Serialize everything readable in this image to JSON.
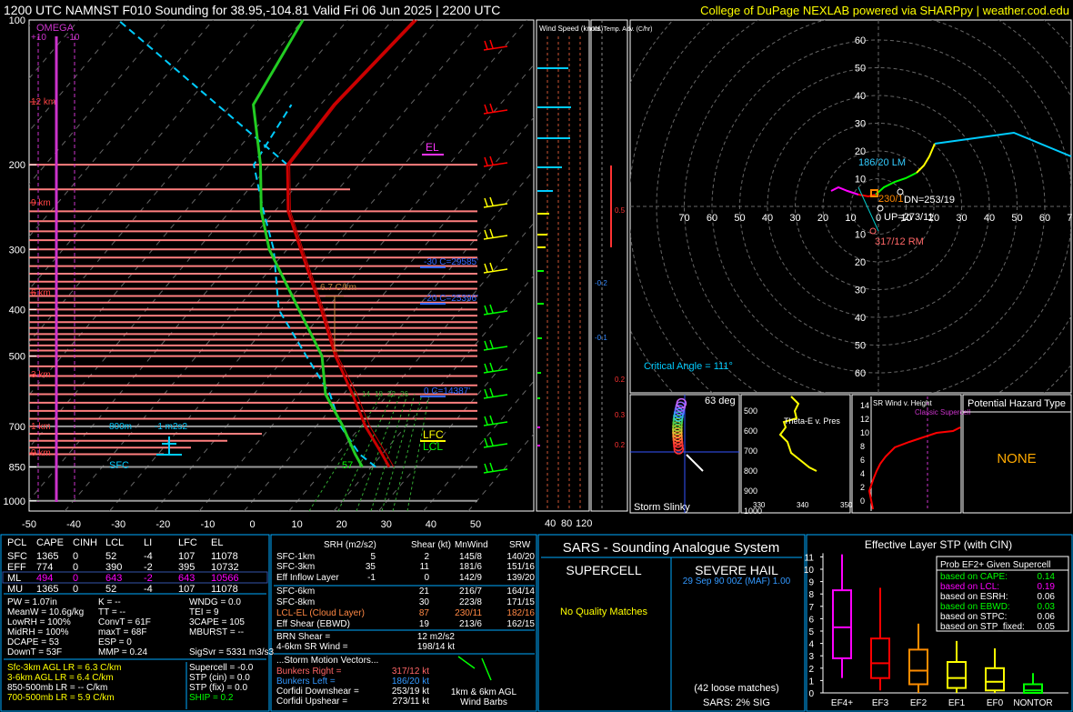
{
  "header": {
    "title": "1200 UTC NAMNST F010 Sounding for 38.95,-104.81 Valid  Fri 06 Jun 2025 | 2200 UTC",
    "credit": "College of DuPage NEXLAB powered via SHARPpy | weather.cod.edu"
  },
  "colors": {
    "temperature": "#ff0000",
    "dewpoint": "#00cc00",
    "wetbulb": "#00ccff",
    "parcel": "#ffffff",
    "level_lines": "#ff6666",
    "axis": "#ffffff"
  },
  "skewt": {
    "pressure_ticks": [
      "100",
      "200",
      "300",
      "400",
      "500",
      "700",
      "850",
      "1000"
    ],
    "temp_ticks": [
      "-50",
      "-40",
      "-30",
      "-20",
      "-10",
      "0",
      "10",
      "20",
      "30",
      "40",
      "50"
    ],
    "omega_label": "OMEGA",
    "omega_ticks": [
      "+10",
      "-10"
    ],
    "height_labels": [
      "12 km",
      "9 km",
      "6 km",
      "3 km",
      "1 km",
      "0 km"
    ],
    "el_label": "EL",
    "lfc_label": "LFC",
    "lcl_label": "LCL",
    "sfc_label": "SFC",
    "m30c_label": "-30 C=29585'",
    "m20c_label": "-20 C=25396'",
    "zero_label": "0 C=14387'",
    "lapse_label": "6.7 C/km",
    "m800_label": "800m",
    "srh_label": "-1 m2s2",
    "sfc_cape_label": "57",
    "mixratio_labels": [
      "10",
      "14",
      "18",
      "22",
      "26"
    ],
    "chart_data": {
      "type": "line",
      "xlabel": "",
      "ylabel": "",
      "ylim": [
        1000,
        100
      ],
      "xlim": [
        -50,
        50
      ],
      "series": [
        {
          "name": "",
          "points": [
            [
              1000,
              null
            ],
            [
              850,
              24
            ],
            [
              800,
              20
            ],
            [
              700,
              11
            ],
            [
              600,
              2
            ],
            [
              500,
              -9
            ],
            [
              400,
              -21
            ],
            [
              300,
              -37
            ],
            [
              250,
              -47
            ],
            [
              200,
              -56
            ],
            [
              150,
              -57
            ],
            [
              100,
              -55
            ]
          ]
        },
        {
          "name": "",
          "points": [
            [
              850,
              18
            ],
            [
              800,
              14
            ],
            [
              700,
              6
            ],
            [
              600,
              -4
            ],
            [
              500,
              -12
            ],
            [
              400,
              -26
            ],
            [
              300,
              -44
            ],
            [
              250,
              -53
            ],
            [
              200,
              -62
            ],
            [
              150,
              -75
            ],
            [
              100,
              -80
            ]
          ]
        }
      ]
    }
  },
  "wind_speed_panel": {
    "title": "Wind Speed (knots)",
    "ticks": [
      "40",
      "80",
      "120"
    ]
  },
  "temp_adv_panel": {
    "title": "Inf. Temp. Adv. (C/hr)",
    "values": [
      "0.5",
      "-0.2",
      "-0.1",
      "0.2",
      "0.3",
      "0.2"
    ]
  },
  "hodograph": {
    "ring_labels": [
      "60",
      "50",
      "40",
      "30",
      "20",
      "10",
      "0",
      "10",
      "20",
      "30",
      "40",
      "50",
      "60",
      "70"
    ],
    "x_labels": [
      "70",
      "60",
      "50",
      "40",
      "30",
      "20",
      "10",
      "0",
      "10",
      "20",
      "30",
      "40",
      "50",
      "60",
      "70"
    ],
    "lm_label": "186/20 LM",
    "rm_label": "317/12 RM",
    "dn_label": "DN=253/19",
    "up_label": "UP=273/11",
    "mean_label": "230/1",
    "critical_angle": "Critical Angle = 111°"
  },
  "slinky": {
    "deg": "63 deg",
    "label": "Storm Slinky"
  },
  "theta_panel": {
    "label": "Theta-E v. Pres",
    "ticks_y": [
      "500",
      "600",
      "700",
      "800",
      "900",
      "1000"
    ],
    "ticks_x": [
      "330",
      "340",
      "350"
    ]
  },
  "srwind_panel": {
    "label": "SR Wind v. Height",
    "ticks": [
      "14",
      "12",
      "10",
      "8",
      "6",
      "4",
      "2",
      "0"
    ],
    "classic": "Classic Supercell"
  },
  "hazard": {
    "title": "Potential Hazard Type",
    "value": "NONE"
  },
  "parcels": {
    "headers": [
      "PCL",
      "CAPE",
      "CINH",
      "LCL",
      "LI",
      "LFC",
      "EL"
    ],
    "rows": [
      [
        "SFC",
        "1365",
        "0",
        "52",
        "-4",
        "107",
        "11078"
      ],
      [
        "EFF",
        "774",
        "0",
        "390",
        "-2",
        "395",
        "10732"
      ],
      [
        "ML",
        "494",
        "0",
        "643",
        "-2",
        "643",
        "10566"
      ],
      [
        "MU",
        "1365",
        "0",
        "52",
        "-4",
        "107",
        "11078"
      ]
    ]
  },
  "indices": {
    "col1": [
      "PW = 1.07in",
      "MeanW = 10.6g/kg",
      "LowRH = 100%",
      "MidRH = 100%",
      "DCAPE = 53",
      "DownT = 53F"
    ],
    "col2": [
      "K = --",
      "TT = --",
      "ConvT = 61F",
      "maxT = 68F",
      "ESP = 0",
      "MMP = 0.24"
    ],
    "col3": [
      "WNDG = 0.0",
      "TEI = 9",
      "3CAPE = 105",
      "MBURST = --",
      "",
      "SigSvr = 5331 m3/s3"
    ]
  },
  "lapse": {
    "rows": [
      "Sfc-3km AGL LR = 6.3 C/km",
      "3-6km AGL LR = 6.4 C/km",
      "850-500mb LR = -- C/km",
      "700-500mb LR = 5.9 C/km"
    ],
    "params": [
      "Supercell = -0.0",
      "STP (cin) = 0.0",
      "STP (fix) = 0.0",
      "SHIP = 0.2"
    ]
  },
  "kinematics": {
    "headers": [
      "SRH (m2/s2)",
      "Shear (kt)",
      "MnWind",
      "SRW"
    ],
    "rows": [
      [
        "SFC-1km",
        "5",
        "2",
        "145/8",
        "140/20"
      ],
      [
        "SFC-3km",
        "35",
        "11",
        "181/6",
        "151/16"
      ],
      [
        "Eff Inflow Layer",
        "-1",
        "0",
        "142/9",
        "139/20"
      ],
      [
        "SFC-6km",
        "",
        "21",
        "216/7",
        "164/14"
      ],
      [
        "SFC-8km",
        "",
        "30",
        "223/8",
        "171/15"
      ],
      [
        "LCL-EL (Cloud Layer)",
        "",
        "87",
        "230/11",
        "182/16"
      ],
      [
        "Eff Shear (EBWD)",
        "",
        "19",
        "213/6",
        "162/15"
      ]
    ],
    "brn_shear_label": "BRN Shear =",
    "brn_shear": "12 m2/s2",
    "sr_wind_label": "4-6km SR Wind =",
    "sr_wind": "198/14 kt",
    "storm_motion_title": "...Storm Motion Vectors...",
    "motions": [
      [
        "Bunkers Right =",
        "317/12 kt"
      ],
      [
        "Bunkers Left =",
        "186/20 kt"
      ],
      [
        "Corfidi Downshear =",
        "253/19 kt"
      ],
      [
        "Corfidi Upshear =",
        "273/11 kt"
      ]
    ],
    "barb_caption_1": "1km & 6km AGL",
    "barb_caption_2": "Wind Barbs"
  },
  "sars": {
    "title": "SARS - Sounding Analogue System",
    "supercell": "SUPERCELL",
    "hail": "SEVERE HAIL",
    "no_match": "No Quality Matches",
    "match": "29 Sep 90 00Z (MAF)  1.00",
    "loose": "(42 loose matches)",
    "sig": "SARS: 2% SIG"
  },
  "stp": {
    "title": "Effective Layer STP (with CIN)",
    "box_title": "Prob EF2+ Given Supercell",
    "probs": [
      [
        "based on CAPE:",
        "0.14"
      ],
      [
        "based on LCL:",
        "0.19"
      ],
      [
        "based on ESRH:",
        "0.06"
      ],
      [
        "based on EBWD:",
        "0.03"
      ],
      [
        "based on STPC:",
        "0.06"
      ],
      [
        "based on STP_fixed:",
        "0.05"
      ]
    ],
    "y_ticks": [
      "11",
      "10",
      "9",
      "8",
      "7",
      "6",
      "5",
      "4",
      "3",
      "2",
      "1",
      "0"
    ],
    "categories": [
      "EF4+",
      "EF3",
      "EF2",
      "EF1",
      "EF0",
      "NONTOR"
    ],
    "chart_data": {
      "type": "bar",
      "title": "Effective Layer STP (with CIN)",
      "categories": [
        "EF4+",
        "EF3",
        "EF2",
        "EF1",
        "EF0",
        "NONTOR"
      ],
      "series": [
        {
          "name": "",
          "values": [
            {
              "whisker_low": 1.2,
              "q1": 2.8,
              "median": 5.3,
              "q3": 8.3,
              "whisker_high": 11.2
            },
            {
              "whisker_low": 0.2,
              "q1": 1.2,
              "median": 2.4,
              "q3": 4.4,
              "whisker_high": 8.5
            },
            {
              "whisker_low": 0.0,
              "q1": 0.7,
              "median": 1.8,
              "q3": 3.5,
              "whisker_high": 5.6
            },
            {
              "whisker_low": 0.0,
              "q1": 0.4,
              "median": 1.2,
              "q3": 2.5,
              "whisker_high": 4.2
            },
            {
              "whisker_low": 0.0,
              "q1": 0.2,
              "median": 0.9,
              "q3": 2.0,
              "whisker_high": 3.6
            },
            {
              "whisker_low": 0.0,
              "q1": 0.0,
              "median": 0.2,
              "q3": 0.7,
              "whisker_high": 1.6
            }
          ]
        }
      ],
      "ylim": [
        0,
        11
      ]
    },
    "box_colors": [
      "#ff00ff",
      "#ff0000",
      "#ff8c00",
      "#ffff00",
      "#ffff00",
      "#00ff00"
    ]
  }
}
